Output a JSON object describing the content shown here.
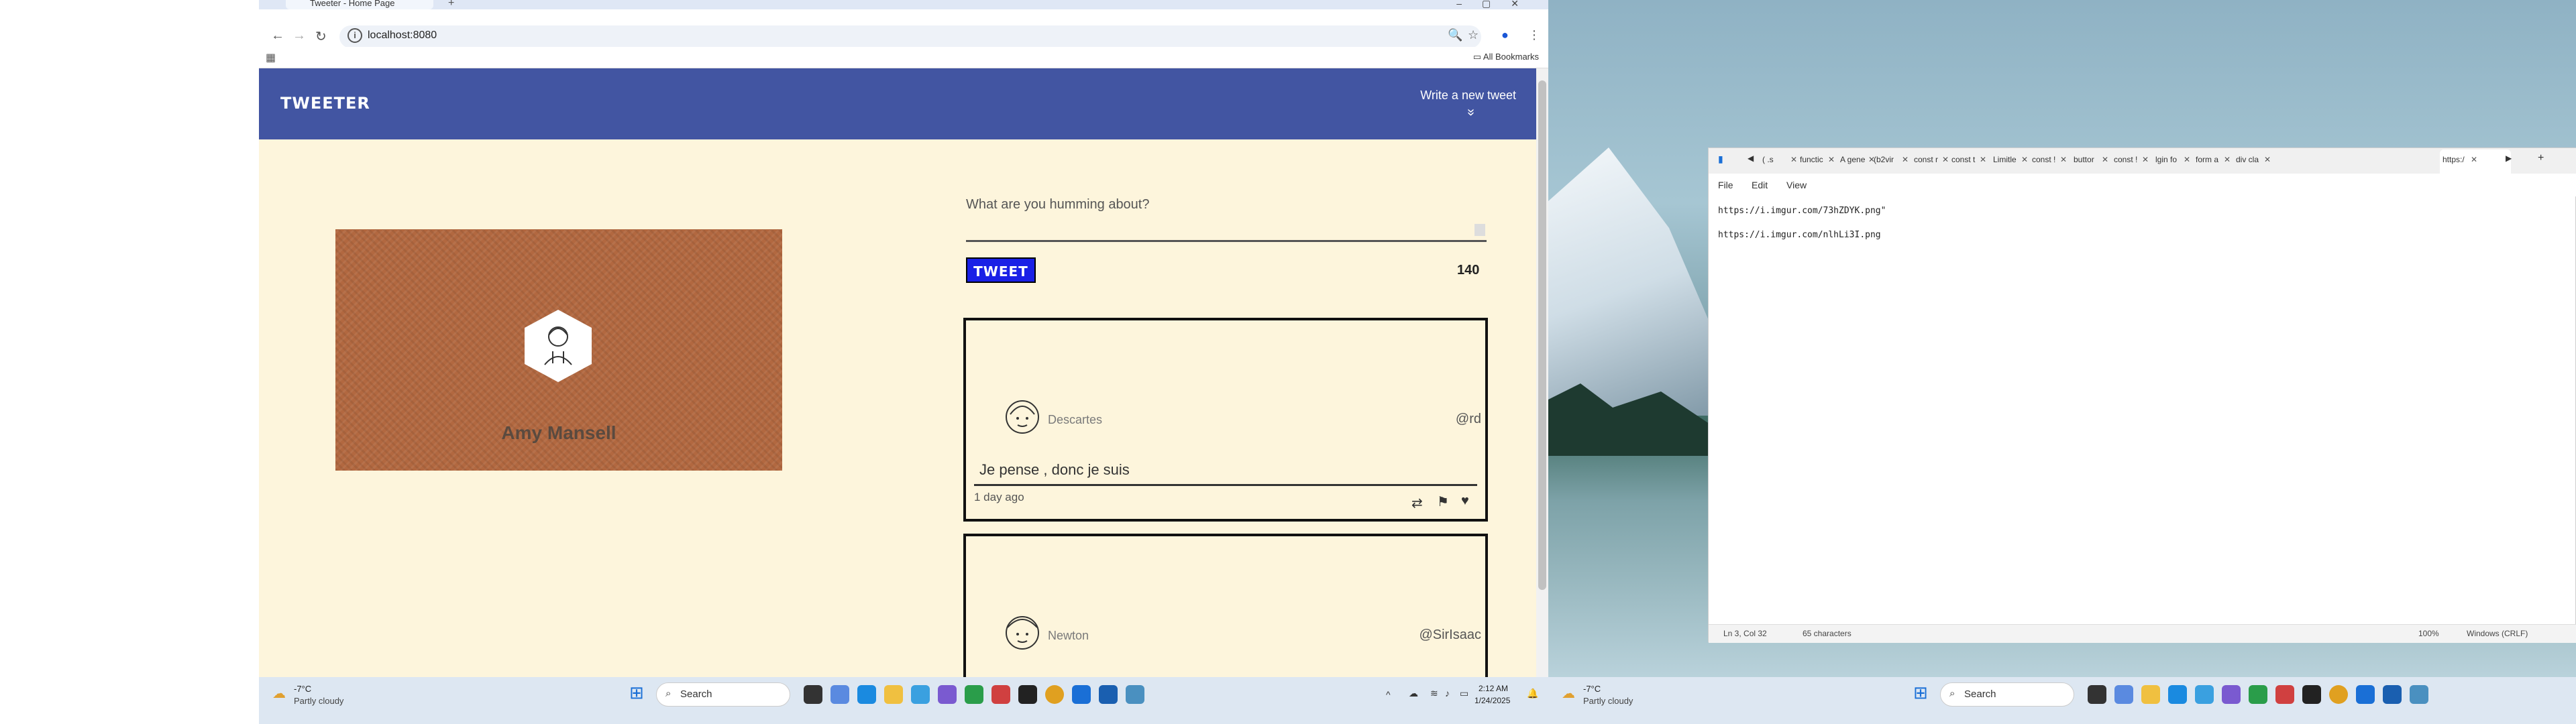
{
  "browser": {
    "tab_title": "Tweeter - Home Page",
    "new_tab": "+",
    "window_controls": "–▢✕",
    "url": "localhost:8080",
    "all_bookmarks": "All Bookmarks"
  },
  "tweeter": {
    "brand": "TWEETER",
    "compose_link": "Write a new tweet",
    "compose_chevron": "»",
    "profile_name": "Amy Mansell",
    "compose_placeholder": "What are you humming about?",
    "tweet_button": "TWEET",
    "counter": "140",
    "tweets": [
      {
        "name": "Descartes",
        "handle": "@rd",
        "content": "Je pense , donc je suis",
        "time": "1 day ago"
      },
      {
        "name": "Newton",
        "handle": "@SirIsaac",
        "content": "",
        "time": ""
      }
    ]
  },
  "taskbar_left": {
    "temp": "-7°C",
    "condition": "Partly cloudy",
    "search": "Search",
    "time": "2:12 AM",
    "date": "1/24/2025"
  },
  "taskbar_right": {
    "temp": "-7°C",
    "condition": "Partly cloudy",
    "search": "Search"
  },
  "notepad": {
    "tabs": [
      "( .s",
      "functic",
      "A gene",
      "(b2vir",
      "const r",
      "const t",
      "Limitle",
      "const !",
      "buttor",
      "const !",
      "lgin fo",
      "form a",
      "div cla",
      "https:/"
    ],
    "menu": [
      "File",
      "Edit",
      "View"
    ],
    "lines": [
      "https://i.imgur.com/73hZDYK.png\"",
      "https://i.imgur.com/nlhLi3I.png"
    ],
    "status_position": "Ln 3, Col 32",
    "status_chars": "65 characters",
    "status_zoom": "100%",
    "status_eol": "Windows (CRLF)"
  },
  "colors": {
    "navbar": "#4255a2",
    "page_bg": "#fdf5dc",
    "tweet_button": "#1a20e6",
    "profile_card": "#b26840"
  }
}
